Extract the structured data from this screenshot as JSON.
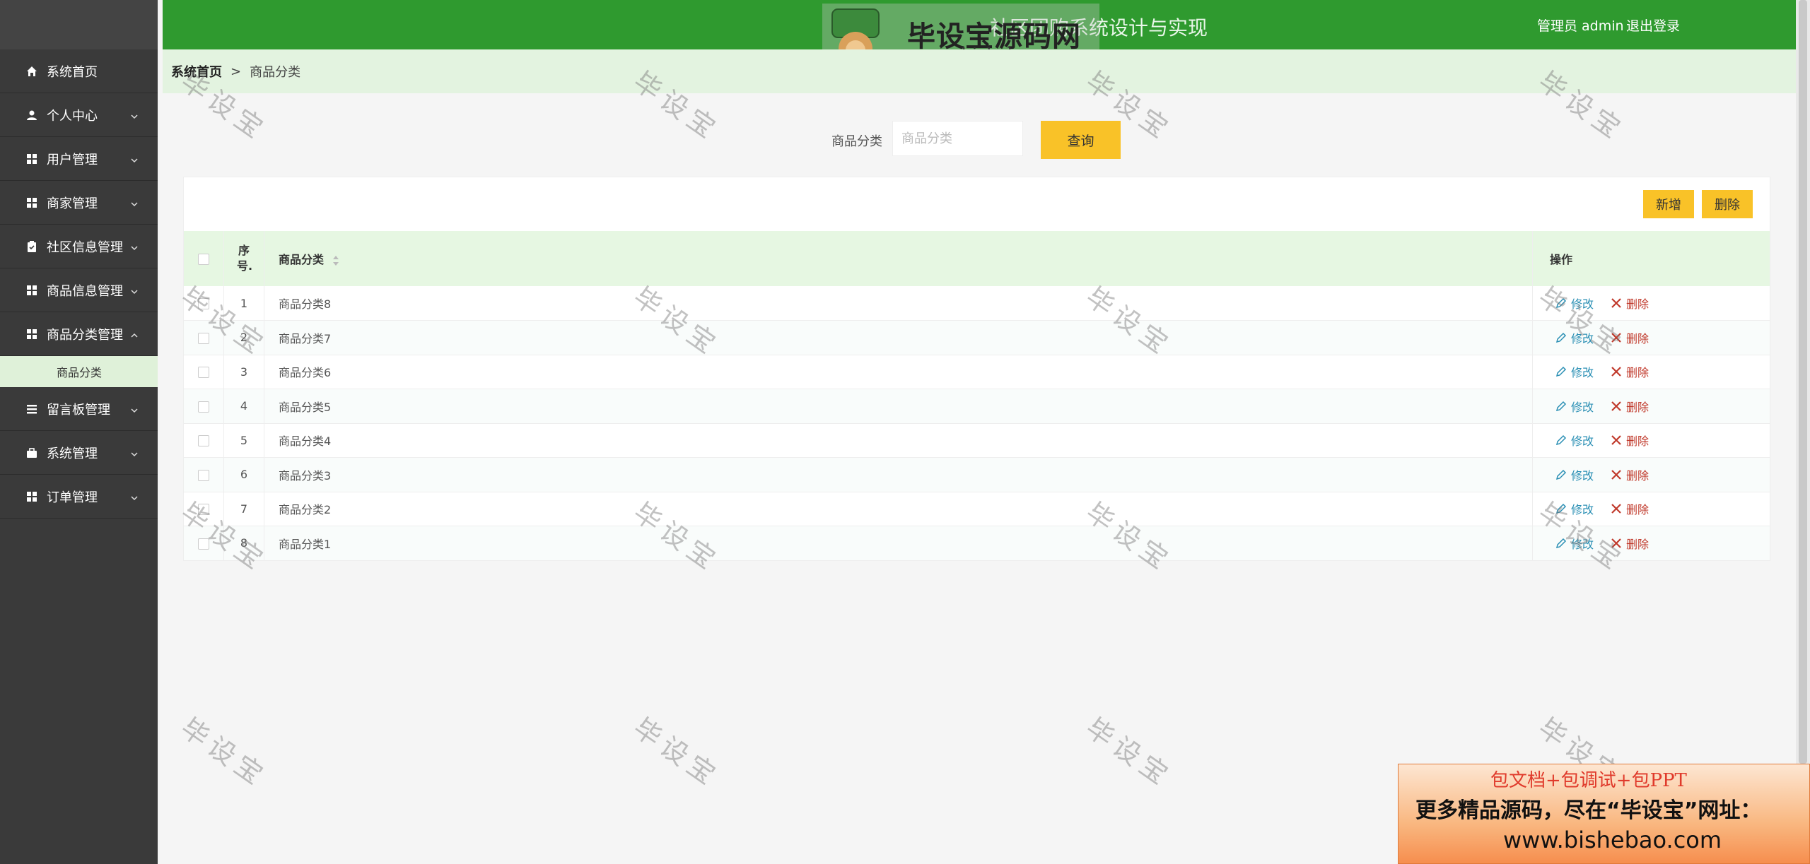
{
  "header": {
    "title": "社区团购系统设计与实现",
    "admin_label": "管理员 admin",
    "logout": "退出登录"
  },
  "logo": {
    "badge": "毕设宝",
    "text": "毕设宝源码网",
    "url": "www.bishebao.com"
  },
  "sidebar": {
    "items": [
      {
        "label": "系统首页",
        "icon": "home-icon",
        "expandable": false
      },
      {
        "label": "个人中心",
        "icon": "user-icon",
        "expandable": true
      },
      {
        "label": "用户管理",
        "icon": "grid-icon",
        "expandable": true
      },
      {
        "label": "商家管理",
        "icon": "grid-icon",
        "expandable": true
      },
      {
        "label": "社区信息管理",
        "icon": "clipboard-icon",
        "expandable": true
      },
      {
        "label": "商品信息管理",
        "icon": "grid-icon",
        "expandable": true
      },
      {
        "label": "商品分类管理",
        "icon": "grid-icon",
        "expandable": true,
        "expanded": true
      },
      {
        "label": "留言板管理",
        "icon": "list-icon",
        "expandable": true
      },
      {
        "label": "系统管理",
        "icon": "briefcase-icon",
        "expandable": true
      },
      {
        "label": "订单管理",
        "icon": "grid-icon",
        "expandable": true
      }
    ],
    "submenu_label": "商品分类"
  },
  "breadcrumb": {
    "home": "系统首页",
    "separator": ">",
    "current": "商品分类"
  },
  "search": {
    "label": "商品分类",
    "placeholder": "商品分类",
    "button": "查询"
  },
  "toolbar": {
    "add": "新增",
    "delete": "删除"
  },
  "table": {
    "headers": {
      "index": "序号.",
      "name": "商品分类",
      "ops": "操作"
    },
    "rows": [
      {
        "index": "1",
        "name": "商品分类8"
      },
      {
        "index": "2",
        "name": "商品分类7"
      },
      {
        "index": "3",
        "name": "商品分类6"
      },
      {
        "index": "4",
        "name": "商品分类5"
      },
      {
        "index": "5",
        "name": "商品分类4"
      },
      {
        "index": "6",
        "name": "商品分类3"
      },
      {
        "index": "7",
        "name": "商品分类2"
      },
      {
        "index": "8",
        "name": "商品分类1"
      }
    ],
    "edit_label": "修改",
    "delete_label": "删除"
  },
  "watermark": "毕设宝",
  "ad": {
    "line1": "包文档+包调试+包PPT",
    "line2": "更多精品源码，尽在“毕设宝”网址：",
    "line3": "www.bishebao.com"
  },
  "colors": {
    "header_green": "#2f9a2f",
    "accent_yellow": "#f9c228",
    "sidebar_bg": "#3a3a3a",
    "edit_blue": "#2a8fb4",
    "delete_red": "#c0392b"
  }
}
